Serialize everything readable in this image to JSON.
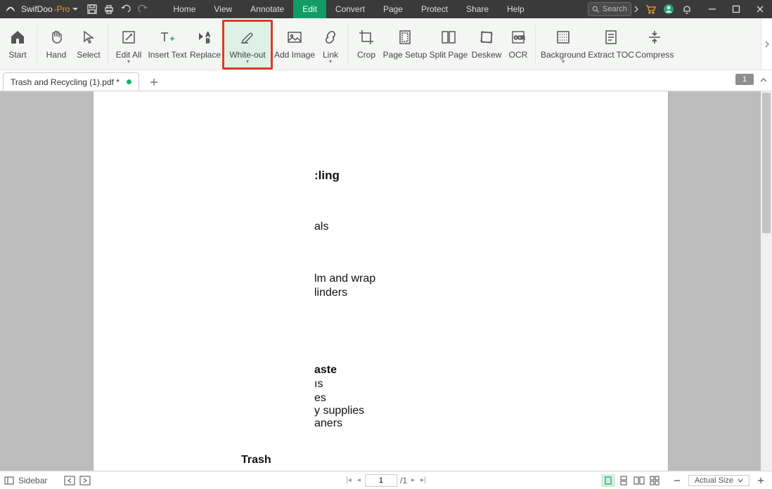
{
  "app": {
    "name": "SwifDoo",
    "suffix": "-Pro"
  },
  "menus": [
    "Home",
    "View",
    "Annotate",
    "Edit",
    "Convert",
    "Page",
    "Protect",
    "Share",
    "Help"
  ],
  "menu_active_index": 3,
  "search_placeholder": "Search",
  "ribbon": {
    "tools": [
      {
        "label": "Start",
        "id": "start",
        "caret": false
      },
      {
        "label": "Hand",
        "id": "hand",
        "caret": false
      },
      {
        "label": "Select",
        "id": "select",
        "caret": false
      },
      {
        "label": "Edit All",
        "id": "edit-all",
        "caret": true
      },
      {
        "label": "Insert Text",
        "id": "insert-text",
        "caret": false
      },
      {
        "label": "Replace",
        "id": "replace",
        "caret": false
      },
      {
        "label": "White-out",
        "id": "white-out",
        "caret": true,
        "highlight": true
      },
      {
        "label": "Add Image",
        "id": "add-image",
        "caret": false
      },
      {
        "label": "Link",
        "id": "link",
        "caret": true
      },
      {
        "label": "Crop",
        "id": "crop",
        "caret": false
      },
      {
        "label": "Page Setup",
        "id": "page-setup",
        "caret": false
      },
      {
        "label": "Split Page",
        "id": "split-page",
        "caret": false
      },
      {
        "label": "Deskew",
        "id": "deskew",
        "caret": false
      },
      {
        "label": "OCR",
        "id": "ocr",
        "caret": false
      },
      {
        "label": "Background",
        "id": "background",
        "caret": true
      },
      {
        "label": "Extract TOC",
        "id": "extract-toc",
        "caret": false
      },
      {
        "label": "Compress",
        "id": "compress",
        "caret": false
      }
    ]
  },
  "tab": {
    "filename": "Trash and Recycling (1).pdf *",
    "page_indicator": "1"
  },
  "document": {
    "lines": {
      "l1": ":ling",
      "l2": "als",
      "l3": "lm and wrap",
      "l4": "linders",
      "l5": "aste",
      "l6": "ıs",
      "l7": "es",
      "l8": "y supplies",
      "l9": "aners",
      "l10": "Trash"
    }
  },
  "status": {
    "sidebar_label": "Sidebar",
    "page_current": "1",
    "page_total": "/1",
    "zoom_label": "Actual Size"
  }
}
